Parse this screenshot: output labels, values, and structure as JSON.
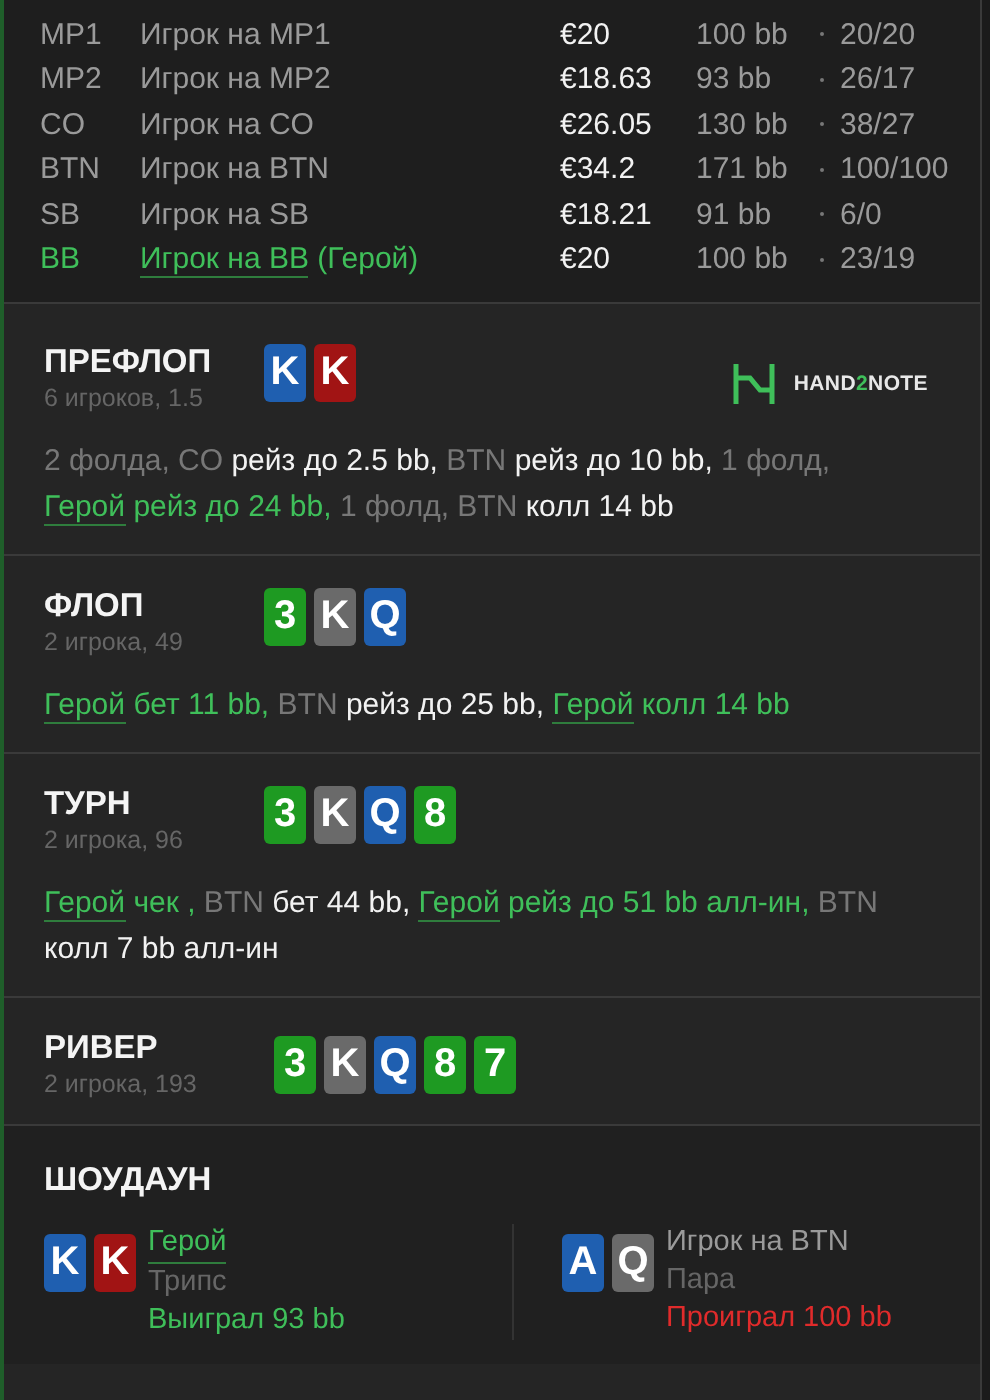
{
  "players": [
    {
      "position": "MP1",
      "name": "Игрок на MP1",
      "hero": false,
      "stack": "€20",
      "bb": "100 bb",
      "ratio": "20/20"
    },
    {
      "position": "MP2",
      "name": "Игрок на MP2",
      "hero": false,
      "stack": "€18.63",
      "bb": "93 bb",
      "ratio": "26/17"
    },
    {
      "position": "CO",
      "name": "Игрок на CO",
      "hero": false,
      "stack": "€26.05",
      "bb": "130 bb",
      "ratio": "38/27"
    },
    {
      "position": "BTN",
      "name": "Игрок на BTN",
      "hero": false,
      "stack": "€34.2",
      "bb": "171 bb",
      "ratio": "100/100"
    },
    {
      "position": "SB",
      "name": "Игрок на SB",
      "hero": false,
      "stack": "€18.21",
      "bb": "91 bb",
      "ratio": "6/0"
    },
    {
      "position": "BB",
      "name": "Игрок на BB",
      "tag": "(Герой)",
      "hero": true,
      "stack": "€20",
      "bb": "100 bb",
      "ratio": "23/19"
    }
  ],
  "streets": [
    {
      "title": "ПРЕФЛОП",
      "info": "6 игроков, 1.5",
      "cards": [
        {
          "rank": "K",
          "color": "#1f5fb0"
        },
        {
          "rank": "K",
          "color": "#a11414"
        }
      ],
      "logo": {
        "before": "HAND",
        "accent": "2",
        "after": "NOTE"
      },
      "actions": [
        {
          "kind": "muted",
          "text": "2 фолда, CO "
        },
        {
          "kind": "action",
          "text": "рейз до 2.5 bb,"
        },
        {
          "kind": "muted",
          "text": " BTN "
        },
        {
          "kind": "action",
          "text": "рейз до 10 bb,"
        },
        {
          "kind": "muted",
          "text": " 1 фолд, "
        },
        {
          "kind": "hero",
          "text": "Герой"
        },
        {
          "kind": "hero_action",
          "text": " рейз до 24 bb,"
        },
        {
          "kind": "muted",
          "text": " 1 фолд, BTN "
        },
        {
          "kind": "action",
          "text": "колл 14 bb"
        }
      ]
    },
    {
      "title": "ФЛОП",
      "info": "2 игрока, 49",
      "cards": [
        {
          "rank": "3",
          "color": "#1e9a22"
        },
        {
          "rank": "K",
          "color": "#6a6a6a"
        },
        {
          "rank": "Q",
          "color": "#1f5fb0"
        }
      ],
      "actions": [
        {
          "kind": "hero",
          "text": "Герой"
        },
        {
          "kind": "hero_action",
          "text": " бет 11 bb,"
        },
        {
          "kind": "muted",
          "text": " BTN "
        },
        {
          "kind": "action",
          "text": "рейз до 25 bb, "
        },
        {
          "kind": "hero",
          "text": "Герой"
        },
        {
          "kind": "hero_action",
          "text": " колл 14 bb"
        }
      ]
    },
    {
      "title": "ТУРН",
      "info": "2 игрока, 96",
      "cards": [
        {
          "rank": "3",
          "color": "#1e9a22"
        },
        {
          "rank": "K",
          "color": "#6a6a6a"
        },
        {
          "rank": "Q",
          "color": "#1f5fb0"
        },
        {
          "rank": "8",
          "color": "#1e9a22"
        }
      ],
      "actions": [
        {
          "kind": "hero",
          "text": "Герой"
        },
        {
          "kind": "hero_action",
          "text": " чек ,"
        },
        {
          "kind": "muted",
          "text": " BTN "
        },
        {
          "kind": "action",
          "text": "бет 44 bb, "
        },
        {
          "kind": "hero",
          "text": "Герой"
        },
        {
          "kind": "hero_action",
          "text": " рейз до 51 bb алл-ин,"
        },
        {
          "kind": "muted",
          "text": " BTN "
        },
        {
          "kind": "action",
          "text": "колл 7 bb алл-ин"
        }
      ]
    },
    {
      "title": "РИВЕР",
      "info": "2 игрока, 193",
      "cards": [
        {
          "rank": "3",
          "color": "#1e9a22"
        },
        {
          "rank": "K",
          "color": "#6a6a6a"
        },
        {
          "rank": "Q",
          "color": "#1f5fb0"
        },
        {
          "rank": "8",
          "color": "#1e9a22"
        },
        {
          "rank": "7",
          "color": "#1e9a22"
        }
      ]
    }
  ],
  "showdown": {
    "title": "ШОУДАУН",
    "hands": [
      {
        "name": "Герой",
        "hero": true,
        "cards": [
          {
            "rank": "K",
            "color": "#1f5fb0"
          },
          {
            "rank": "K",
            "color": "#a11414"
          }
        ],
        "hand": "Трипс",
        "result": "Выиграл 93 bb",
        "won": true
      },
      {
        "name": "Игрок на BTN",
        "hero": false,
        "cards": [
          {
            "rank": "A",
            "color": "#1f5fb0"
          },
          {
            "rank": "Q",
            "color": "#6a6a6a"
          }
        ],
        "hand": "Пара",
        "result": "Проиграл 100 bb",
        "won": false
      }
    ]
  }
}
